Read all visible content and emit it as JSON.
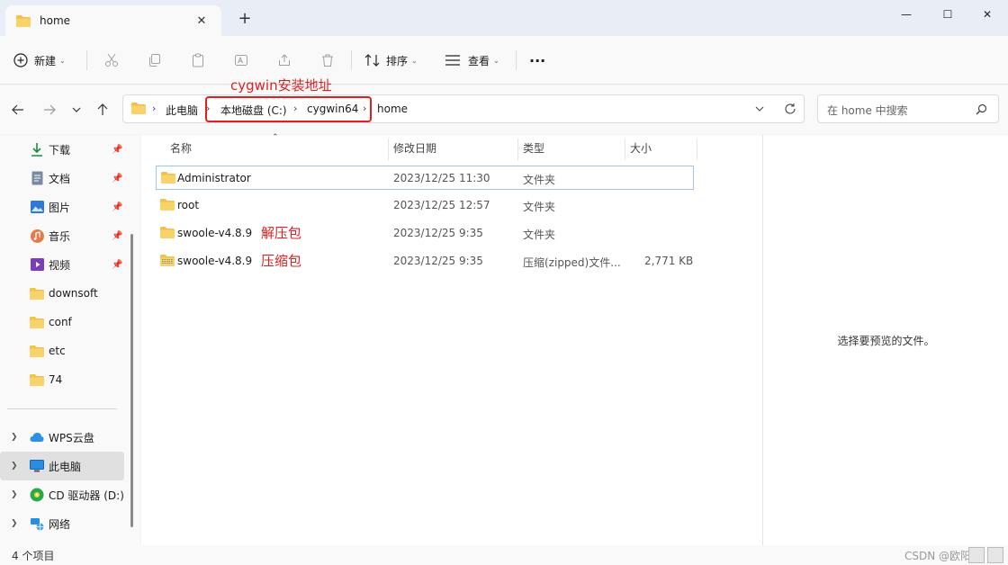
{
  "tab": {
    "title": "home",
    "close": "✕",
    "new": "+"
  },
  "window": {
    "minimize": "—",
    "maximize": "☐",
    "close": "✕"
  },
  "toolbar": {
    "new_label": "新建",
    "sort_label": "排序",
    "view_label": "查看",
    "more_label": "···"
  },
  "address": {
    "crumbs": [
      "此电脑",
      "本地磁盘 (C:)",
      "cygwin64",
      "home"
    ],
    "annotation": "cygwin安装地址"
  },
  "search": {
    "placeholder": "在 home 中搜索"
  },
  "sidebar": {
    "quick": [
      {
        "label": "下载",
        "icon": "download-icon",
        "pinned": true
      },
      {
        "label": "文档",
        "icon": "document-icon",
        "pinned": true
      },
      {
        "label": "图片",
        "icon": "pictures-icon",
        "pinned": true
      },
      {
        "label": "音乐",
        "icon": "music-icon",
        "pinned": true
      },
      {
        "label": "视频",
        "icon": "video-icon",
        "pinned": true
      },
      {
        "label": "downsoft",
        "icon": "folder-icon",
        "pinned": false
      },
      {
        "label": "conf",
        "icon": "folder-icon",
        "pinned": false
      },
      {
        "label": "etc",
        "icon": "folder-icon",
        "pinned": false
      },
      {
        "label": "74",
        "icon": "folder-icon",
        "pinned": false
      }
    ],
    "locations": [
      {
        "label": "WPS云盘",
        "icon": "cloud-icon"
      },
      {
        "label": "此电脑",
        "icon": "computer-icon"
      },
      {
        "label": "CD 驱动器 (D:)",
        "icon": "cd-drive-icon"
      },
      {
        "label": "网络",
        "icon": "network-icon"
      }
    ]
  },
  "columns": {
    "name": "名称",
    "date": "修改日期",
    "type": "类型",
    "size": "大小"
  },
  "files": [
    {
      "name": "Administrator",
      "date": "2023/12/25 11:30",
      "type": "文件夹",
      "size": "",
      "kind": "folder",
      "note": ""
    },
    {
      "name": "root",
      "date": "2023/12/25 12:57",
      "type": "文件夹",
      "size": "",
      "kind": "folder",
      "note": ""
    },
    {
      "name": "swoole-v4.8.9",
      "date": "2023/12/25 9:35",
      "type": "文件夹",
      "size": "",
      "kind": "folder",
      "note": "解压包"
    },
    {
      "name": "swoole-v4.8.9",
      "date": "2023/12/25 9:35",
      "type": "压缩(zipped)文件...",
      "size": "2,771 KB",
      "kind": "zip",
      "note": "压缩包"
    }
  ],
  "preview": {
    "empty_text": "选择要预览的文件。"
  },
  "status": {
    "count": "4 个项目"
  },
  "watermark": "CSDN @欧阳修",
  "colors": {
    "accent_red": "#e02020",
    "folder": "#f3c14b",
    "selection_border": "#9ec5e6"
  }
}
